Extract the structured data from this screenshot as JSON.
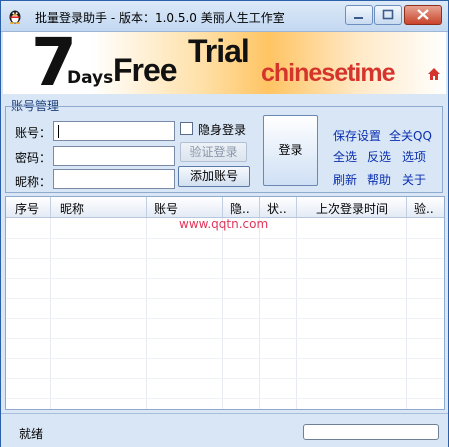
{
  "window": {
    "title": "批量登录助手 - 版本：1.0.5.0  美丽人生工作室",
    "icons": {
      "app": "qq-penguin-icon",
      "minimize": "minimize-icon",
      "maximize": "maximize-icon",
      "close": "close-icon"
    }
  },
  "banner": {
    "big_number": "7",
    "days": "Days",
    "free": "Free",
    "trial": "Trial",
    "brand": "chinesetime",
    "icon": "home-icon"
  },
  "account": {
    "section_label": "账号管理",
    "account_label": "账号：",
    "password_label": "密码：",
    "nickname_label": "昵称：",
    "account_value": "",
    "password_value": "",
    "nickname_value": "",
    "hidden_login_label": "隐身登录",
    "hidden_login_checked": false,
    "verify_button": "验证登录",
    "add_button": "添加账号",
    "login_button": "登录"
  },
  "links": {
    "save_settings": "保存设置",
    "close_all_qq": "全关QQ",
    "select_all": "全选",
    "invert": "反选",
    "options": "选项",
    "refresh": "刷新",
    "help": "帮助",
    "about": "关于"
  },
  "table": {
    "columns": [
      "序号",
      "昵称",
      "账号",
      "隐..",
      "状..",
      "上次登录时间",
      "验.."
    ],
    "rows": [],
    "watermark": "www.qqtn.com"
  },
  "status": {
    "text": "就绪",
    "progress": 0
  },
  "colors": {
    "link": "#0a2fb0",
    "brand_red": "#d4342b",
    "window_border": "#2b5fa8",
    "watermark": "#e0365a"
  }
}
